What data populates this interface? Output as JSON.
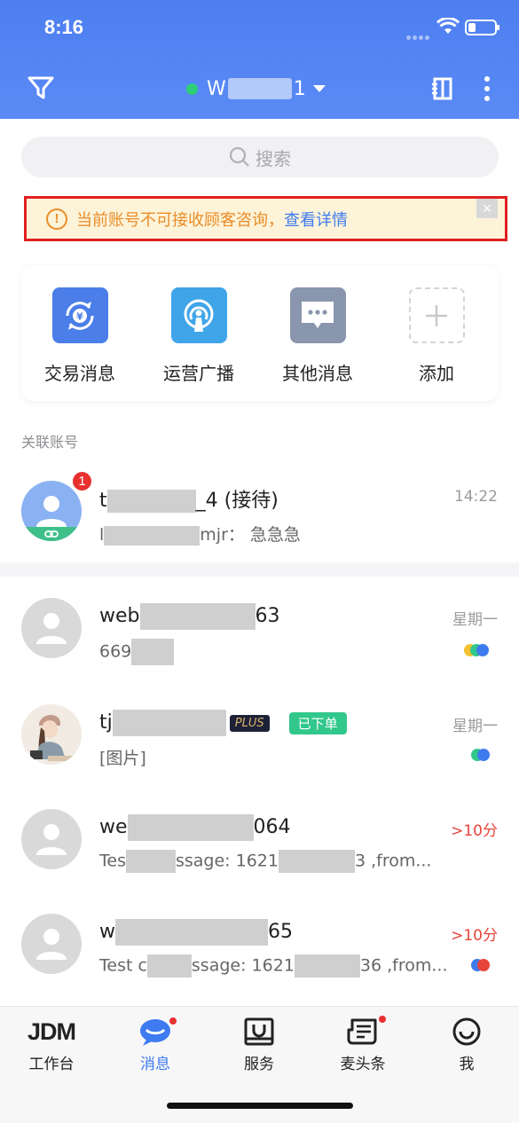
{
  "status_bar": {
    "time": "8:16"
  },
  "header": {
    "account_prefix": "W",
    "account_suffix": "1",
    "online_color": "#2fcf7a",
    "left_icon": "filter-icon",
    "right_icons": [
      "contacts-book-icon",
      "more-vertical-icon"
    ]
  },
  "search": {
    "placeholder": "搜索"
  },
  "warning": {
    "text": "当前账号不可接收顾客咨询，",
    "link": "查看详情",
    "icon": "!"
  },
  "quick_actions": [
    {
      "label": "交易消息",
      "icon": "trade-message-icon",
      "color": "#4b7ee8"
    },
    {
      "label": "运营广播",
      "icon": "broadcast-icon",
      "color": "#3fa5e8"
    },
    {
      "label": "其他消息",
      "icon": "other-message-icon",
      "color": "#8a96ad"
    },
    {
      "label": "添加",
      "icon": "add-icon",
      "color": "#ffffff"
    }
  ],
  "linked_section": {
    "title": "关联账号"
  },
  "linked_account": {
    "name_prefix": "t",
    "name_suffix": "_4 (接待)",
    "sub_prefix": "l",
    "sub_suffix": "mjr： 急急急",
    "time": "14:22",
    "badge": "1"
  },
  "conversations": [
    {
      "name_prefix": "web",
      "name_suffix": "63",
      "sub": "669",
      "time": "星期一",
      "time_color": "gray"
    },
    {
      "name_prefix": "tj",
      "plus": "PLUS",
      "tag": "已下单",
      "sub": "[图片]",
      "time": "星期一",
      "time_color": "gray"
    },
    {
      "name_prefix": "we",
      "name_suffix": "064",
      "sub_prefix": "Tes",
      "sub_mid": "ssage: 1621",
      "sub_suffix": "3 ,from...",
      "time": ">10分",
      "time_color": "red"
    },
    {
      "name_prefix": "w",
      "name_suffix": "65",
      "sub_prefix": "Test c",
      "sub_mid": "ssage: 1621",
      "sub_suffix": "36 ,from...",
      "time": ">10分",
      "time_color": "red"
    }
  ],
  "tabbar": [
    {
      "label": "工作台",
      "icon": "jdm-logo-icon",
      "active": false,
      "dot": false,
      "logo_text": "JDM"
    },
    {
      "label": "消息",
      "icon": "message-bubble-icon",
      "active": true,
      "dot": true
    },
    {
      "label": "服务",
      "icon": "service-icon",
      "active": false,
      "dot": false
    },
    {
      "label": "麦头条",
      "icon": "news-icon",
      "active": false,
      "dot": true
    },
    {
      "label": "我",
      "icon": "profile-smile-icon",
      "active": false,
      "dot": false
    }
  ]
}
